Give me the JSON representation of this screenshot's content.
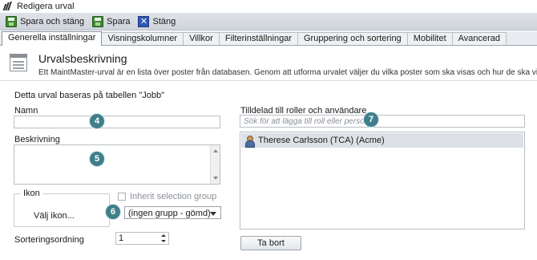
{
  "window": {
    "title": "Redigera urval"
  },
  "toolbar": {
    "save_and_close": "Spara och stäng",
    "save": "Spara",
    "close": "Stäng"
  },
  "tabs": [
    {
      "label": "Generella inställningar",
      "active": true
    },
    {
      "label": "Visningskolumner",
      "active": false
    },
    {
      "label": "Villkor",
      "active": false
    },
    {
      "label": "Filterinställningar",
      "active": false
    },
    {
      "label": "Gruppering och sortering",
      "active": false
    },
    {
      "label": "Mobilitet",
      "active": false
    },
    {
      "label": "Avancerad",
      "active": false
    }
  ],
  "header": {
    "title": "Urvalsbeskrivning",
    "description": "Ett MaintMaster-urval är en lista över poster från databasen. Genom att utforma urvalet väljer du vilka poster som ska visas och hur de ska visas. Om urvalet tillo"
  },
  "form": {
    "based_on": "Detta urval baseras på tabellen \"Jobb\"",
    "name_label": "Namn",
    "name_value": "",
    "description_label": "Beskrivning",
    "description_value": "",
    "icon_group_label": "Ikon",
    "choose_icon": "Välj ikon...",
    "inherit_label": "Inherit selection group",
    "group_select_value": "(ingen grupp - gömd)",
    "sort_label": "Sorteringsordning",
    "sort_value": "1"
  },
  "roles": {
    "label": "Tilldelad till roller och användare",
    "search_placeholder": "Sök för att lägga till roll eller person",
    "items": [
      {
        "name": "Therese Carlsson (TCA) (Acme)"
      }
    ],
    "remove_button": "Ta bort"
  },
  "callouts": [
    "4",
    "5",
    "6",
    "7"
  ],
  "colors": {
    "callout": "#3f7f8a",
    "toolbar": "#d6dbe1"
  }
}
